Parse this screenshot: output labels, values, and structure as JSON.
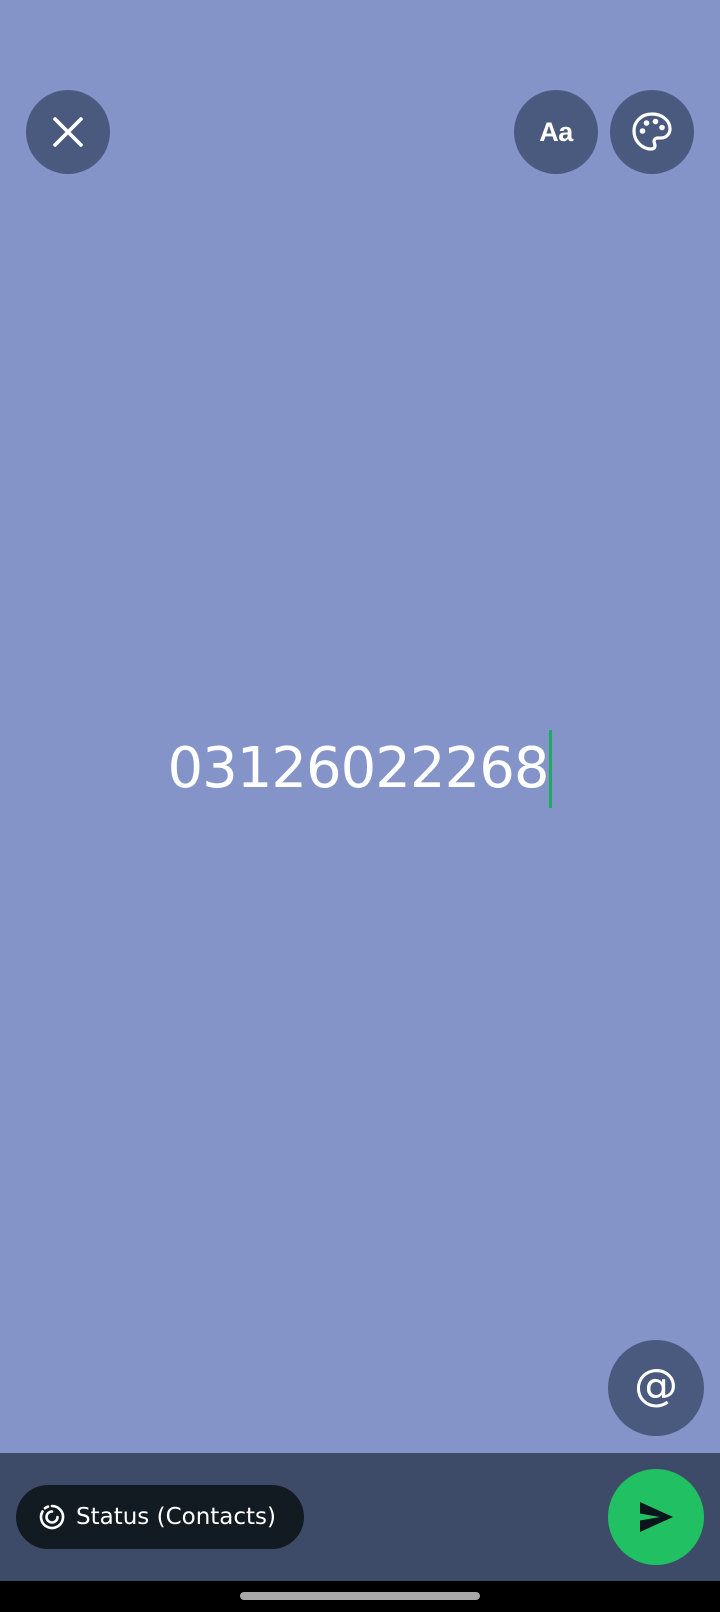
{
  "composer": {
    "text": "03126022268",
    "background_color": "#8494C8",
    "text_color": "#FFFFFF",
    "caret_color": "#1DAA61"
  },
  "toolbar": {
    "close_icon": "close-icon",
    "font_label": "Aa",
    "palette_icon": "palette-icon",
    "button_color": "#4A5A7E"
  },
  "mention": {
    "icon": "at-sign-icon",
    "glyph": "@"
  },
  "bottom_bar": {
    "background_color": "#3D4B68",
    "audience_label": "Status (Contacts)",
    "audience_icon": "status-ring-icon",
    "chip_color": "#121B22",
    "send_icon": "send-icon",
    "send_color": "#21C063"
  },
  "system_nav": {
    "background_color": "#000000",
    "handle_color": "#A8A8A8"
  }
}
